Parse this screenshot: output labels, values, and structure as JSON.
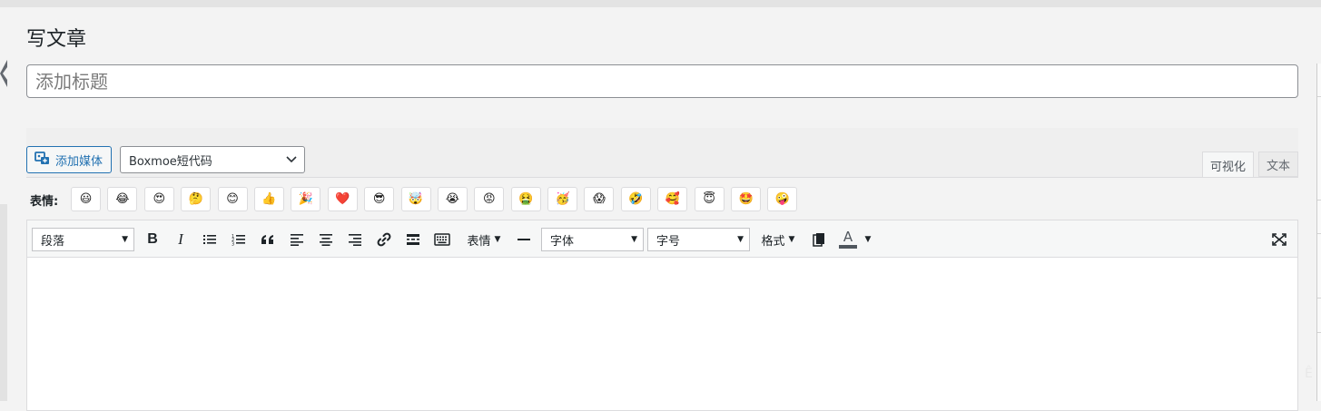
{
  "page": {
    "title": "写文章"
  },
  "title_field": {
    "placeholder": "添加标题",
    "value": ""
  },
  "media_button": {
    "label": "添加媒体",
    "icon": "add-media-icon"
  },
  "shortcode_select": {
    "value": "Boxmoe短代码"
  },
  "editor_tabs": {
    "visual": "可视化",
    "text": "文本",
    "active": "visual"
  },
  "emoji_bar": {
    "label": "表情:",
    "items": [
      {
        "id": "grin",
        "glyph": "😃"
      },
      {
        "id": "joy",
        "glyph": "😂"
      },
      {
        "id": "heart-eyes",
        "glyph": "😍"
      },
      {
        "id": "thinking",
        "glyph": "🤔"
      },
      {
        "id": "blush",
        "glyph": "😊"
      },
      {
        "id": "thumbs-up",
        "glyph": "👍"
      },
      {
        "id": "party-popper",
        "glyph": "🎉"
      },
      {
        "id": "heart",
        "glyph": "❤️"
      },
      {
        "id": "sunglasses",
        "glyph": "😎"
      },
      {
        "id": "mind-blown",
        "glyph": "🤯"
      },
      {
        "id": "sob",
        "glyph": "😭"
      },
      {
        "id": "angry",
        "glyph": "😡"
      },
      {
        "id": "nauseated",
        "glyph": "🤮"
      },
      {
        "id": "partying",
        "glyph": "🥳"
      },
      {
        "id": "scream",
        "glyph": "😱"
      },
      {
        "id": "rofl",
        "glyph": "🤣"
      },
      {
        "id": "smiling-hearts",
        "glyph": "🥰"
      },
      {
        "id": "innocent",
        "glyph": "😇"
      },
      {
        "id": "star-struck",
        "glyph": "🤩"
      },
      {
        "id": "zany",
        "glyph": "🤪"
      }
    ]
  },
  "toolbar": {
    "format_select": "段落",
    "bold": "B",
    "italic": "I",
    "emoji_menu": "表情",
    "font_select": "字体",
    "size_select": "字号",
    "styles_menu": "格式",
    "text_color": "A"
  },
  "corner_fragment": "Ê"
}
